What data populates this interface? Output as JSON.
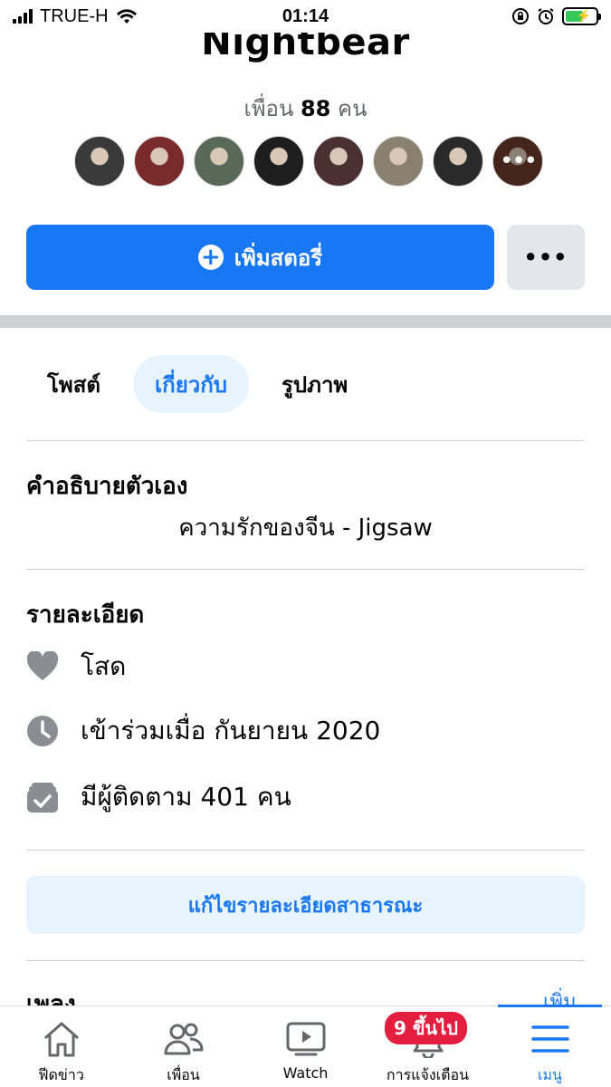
{
  "status_bar": {
    "carrier": "TRUE-H",
    "time": "01:14"
  },
  "profile": {
    "name": "Nightbear",
    "friends_prefix": "เพื่อน",
    "friends_count": "88",
    "friends_suffix": "คน",
    "friend_avatars": [
      "#3a3a3a",
      "#7a2a2a",
      "#5a6a5a",
      "#1e1e1e",
      "#4a3030",
      "#8a8070",
      "#2a2a2a",
      "#6a3a2a"
    ],
    "more_avatars_label": "•••"
  },
  "actions": {
    "add_story_label": "เพิ่มสตอรี่",
    "more_label": "•••"
  },
  "tabs": [
    {
      "label": "โพสต์",
      "active": false
    },
    {
      "label": "เกี่ยวกับ",
      "active": true
    },
    {
      "label": "รูปภาพ",
      "active": false
    }
  ],
  "bio": {
    "title": "คำอธิบายตัวเอง",
    "text": "ความรักของจีน - Jigsaw"
  },
  "details": {
    "title": "รายละเอียด",
    "relationship": "โสด",
    "joined": "เข้าร่วมเมื่อ กันยายน  2020",
    "followers": "มีผู้ติดตาม 401 คน"
  },
  "edit_details_label": "แก้ไขรายละเอียดสาธารณะ",
  "songs": {
    "title": "เพลง",
    "more_label": "เพิ่ม"
  },
  "bottom_nav": {
    "items": [
      {
        "label": "ฟีดข่าว"
      },
      {
        "label": "เพื่อน"
      },
      {
        "label": "Watch"
      },
      {
        "label": "การแจ้งเตือน",
        "badge": "9 ขึ้นไป"
      },
      {
        "label": "เมนู"
      }
    ]
  },
  "colors": {
    "accent": "#1877f2",
    "badge": "#e41e3f"
  }
}
